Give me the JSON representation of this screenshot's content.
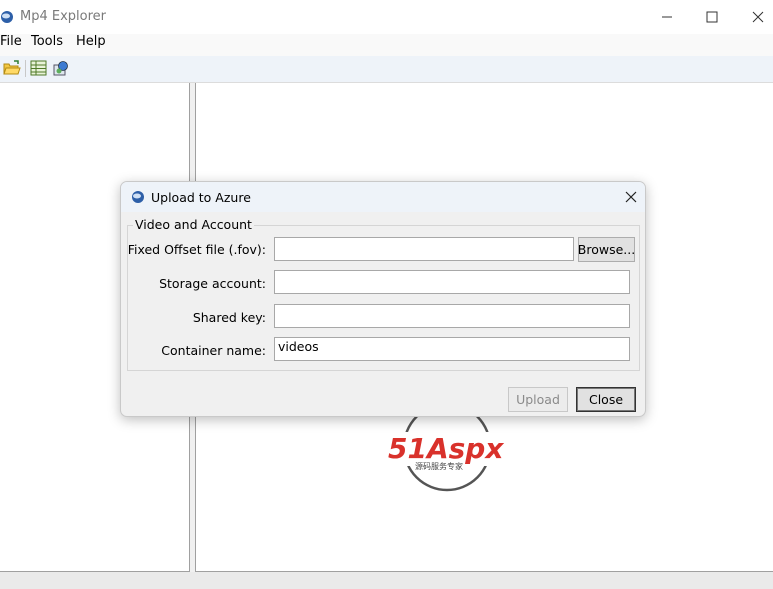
{
  "window": {
    "title": "Mp4 Explorer"
  },
  "menu": {
    "items": [
      "File",
      "Tools",
      "Help"
    ]
  },
  "toolbar": {
    "icons": [
      "open-folder-icon",
      "grid-icon",
      "upload-icon"
    ]
  },
  "dialog": {
    "title": "Upload to Azure",
    "group_label": "Video and Account",
    "fields": {
      "fov_label": "Fixed Offset file (.fov):",
      "fov_value": "",
      "storage_label": "Storage account:",
      "storage_value": "",
      "key_label": "Shared key:",
      "key_value": "",
      "container_label": "Container name:",
      "container_value": "videos"
    },
    "browse_label": "Browse...",
    "upload_label": "Upload",
    "close_label": "Close"
  },
  "watermark": {
    "logo_text": "51Aspx",
    "tagline": "源码服务专家"
  }
}
